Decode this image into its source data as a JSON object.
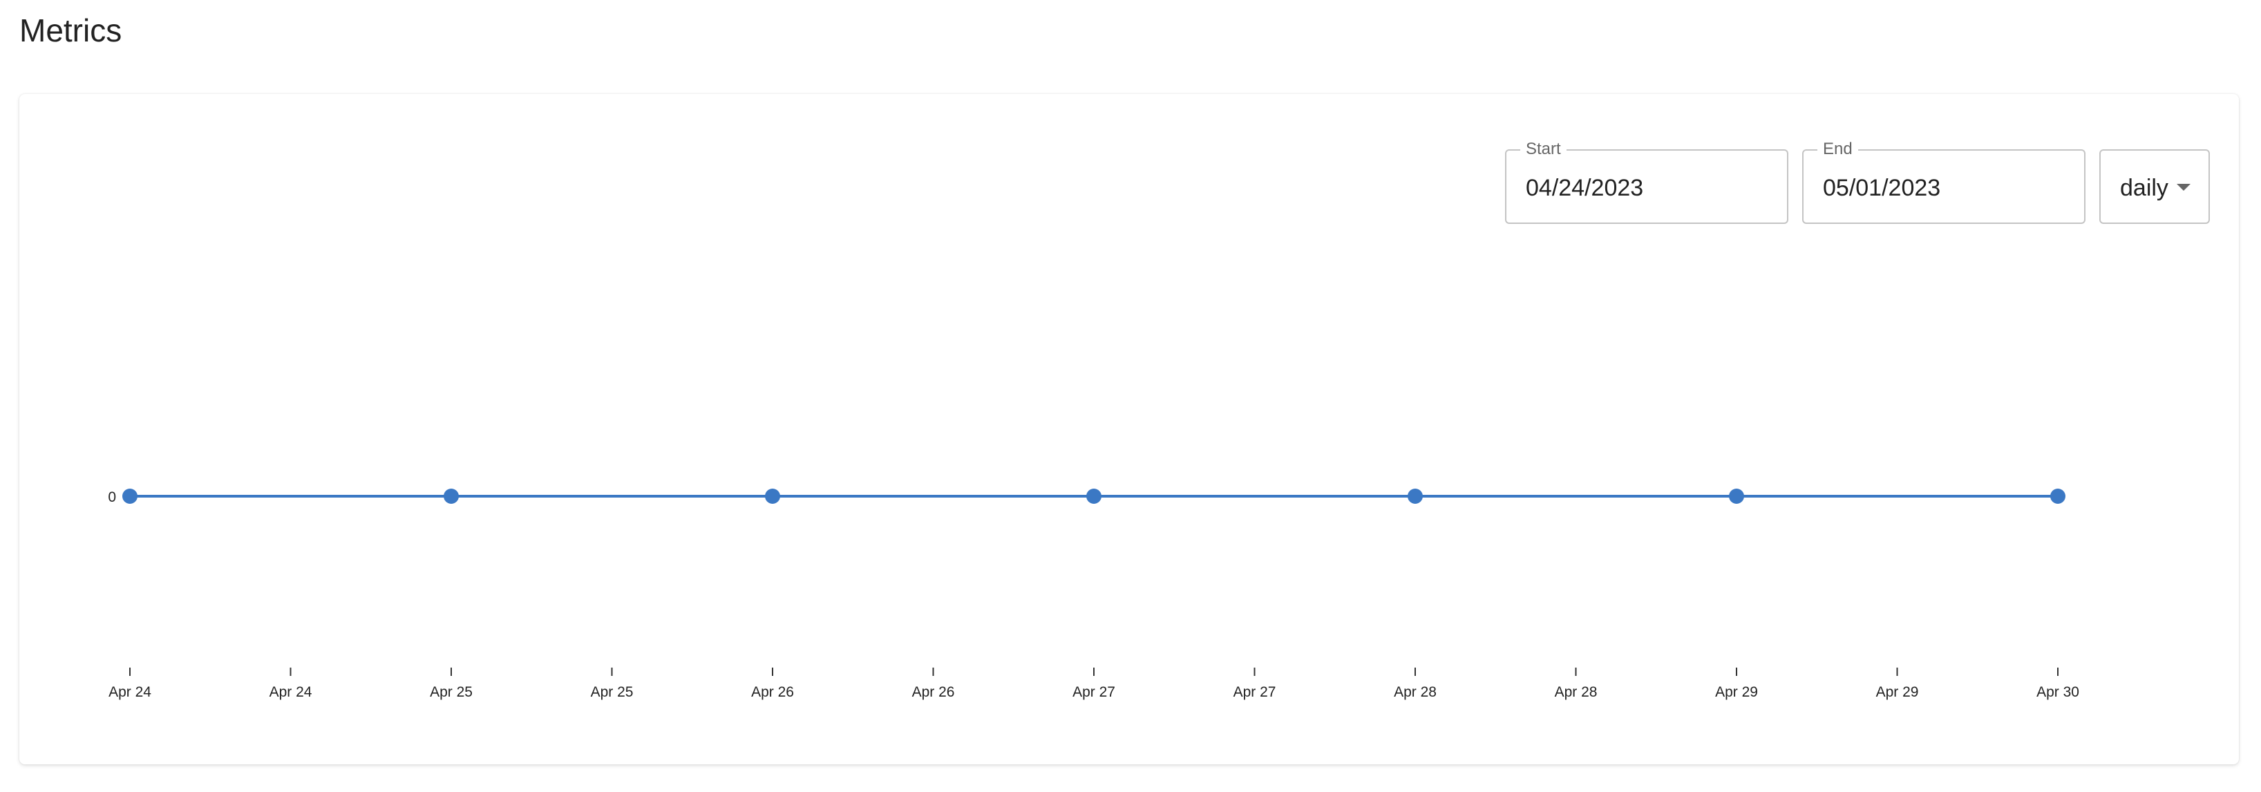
{
  "page": {
    "title": "Metrics"
  },
  "filters": {
    "start": {
      "label": "Start",
      "value": "04/24/2023"
    },
    "end": {
      "label": "End",
      "value": "05/01/2023"
    },
    "interval": {
      "value": "daily"
    }
  },
  "colors": {
    "series": "#3b78c4",
    "axis": "#333333"
  },
  "chart_data": {
    "type": "line",
    "title": "",
    "xlabel": "",
    "ylabel": "",
    "x": [
      "Apr 24",
      "Apr 25",
      "Apr 26",
      "Apr 27",
      "Apr 28",
      "Apr 29",
      "Apr 30"
    ],
    "series": [
      {
        "values": [
          0,
          0,
          0,
          0,
          0,
          0,
          0
        ]
      }
    ],
    "x_tick_labels": [
      "Apr 24",
      "Apr 24",
      "Apr 25",
      "Apr 25",
      "Apr 26",
      "Apr 26",
      "Apr 27",
      "Apr 27",
      "Apr 28",
      "Apr 28",
      "Apr 29",
      "Apr 29",
      "Apr 30"
    ],
    "y_tick_labels": [
      "0"
    ],
    "grid": false,
    "markers": true
  }
}
